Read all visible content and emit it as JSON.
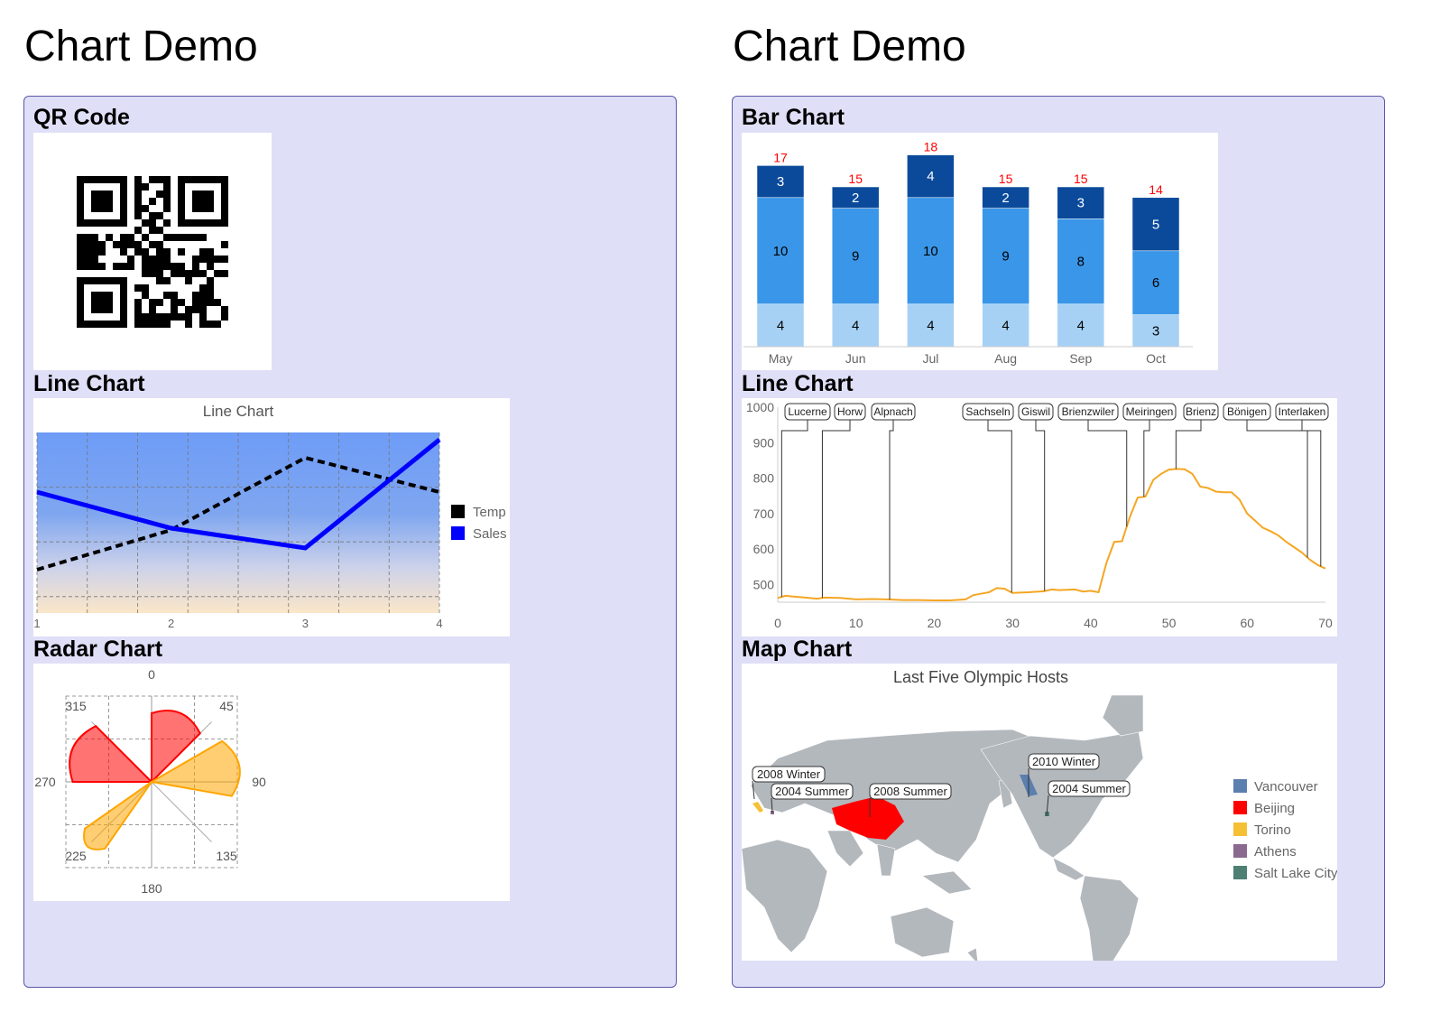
{
  "left": {
    "title": "Chart Demo",
    "qr_title": "QR Code",
    "line_title": "Line Chart",
    "radar_title": "Radar Chart"
  },
  "right": {
    "title": "Chart Demo",
    "bar_title": "Bar Chart",
    "line_title": "Line Chart",
    "map_title": "Map Chart"
  },
  "colors": {
    "panel_bg": "#dfdff7",
    "panel_border": "#5a5aa8",
    "bar_light": "#a6d1f5",
    "bar_mid": "#3a96e8",
    "bar_dark": "#0b4a9b",
    "total_label": "#ff0000",
    "profile_line": "#f5a623",
    "map_land": "#b3b8bd"
  },
  "chart_data": [
    {
      "id": "bar",
      "type": "bar",
      "stacked": true,
      "categories": [
        "May",
        "Jun",
        "Jul",
        "Aug",
        "Sep",
        "Oct"
      ],
      "series": [
        {
          "values": [
            4,
            4,
            4,
            4,
            4,
            3
          ]
        },
        {
          "values": [
            10,
            9,
            10,
            9,
            8,
            6
          ]
        },
        {
          "values": [
            3,
            2,
            4,
            2,
            3,
            5
          ]
        }
      ],
      "totals": [
        17,
        15,
        18,
        15,
        15,
        14
      ],
      "ylim": [
        0,
        19
      ],
      "xlabel": "",
      "ylabel": ""
    },
    {
      "id": "line-left",
      "type": "line",
      "title": "Line Chart",
      "x": [
        1,
        2,
        3,
        4
      ],
      "xticks": [
        "1",
        "2",
        "3",
        "4"
      ],
      "series": [
        {
          "name": "Temp",
          "values": [
            2.4,
            4.6,
            8.6,
            6.7
          ],
          "color": "#000000",
          "style": "dashed"
        },
        {
          "name": "Sales",
          "values": [
            6.7,
            4.7,
            3.6,
            9.6
          ],
          "color": "#0000ff",
          "style": "solid"
        }
      ],
      "ylim": [
        0,
        10
      ],
      "grid": true,
      "legend": "right",
      "background": "gradient blue to beige"
    },
    {
      "id": "radar",
      "type": "radar",
      "angle_ticks": [
        "0",
        "45",
        "90",
        "135",
        "180",
        "225",
        "270",
        "315"
      ],
      "series": [
        {
          "color": "#ff0000",
          "petals": [
            {
              "from": 270,
              "to": 315,
              "r": 0.92
            },
            {
              "from": 0,
              "to": 45,
              "r": 0.8
            }
          ]
        },
        {
          "color": "#ffa500",
          "petals": [
            {
              "from": 60,
              "to": 100,
              "r": 0.95
            },
            {
              "from": 215,
              "to": 235,
              "r": 0.95
            }
          ]
        }
      ],
      "grid": true
    },
    {
      "id": "line-right",
      "type": "line",
      "xlim": [
        0,
        70
      ],
      "xticks": [
        "0",
        "10",
        "20",
        "30",
        "40",
        "50",
        "60",
        "70"
      ],
      "ylim": [
        450,
        1000
      ],
      "yticks": [
        "500",
        "600",
        "700",
        "800",
        "900",
        "1000"
      ],
      "series": [
        {
          "color": "#f5a623",
          "x": [
            0,
            1,
            2,
            4,
            5,
            6,
            8,
            10,
            12,
            14,
            16,
            18,
            20,
            22,
            24,
            25,
            26,
            27,
            28,
            29,
            30,
            32,
            34,
            35,
            36,
            38,
            39,
            40,
            41,
            42,
            43,
            44,
            45,
            46,
            47,
            48,
            49,
            50,
            51,
            52,
            53,
            54,
            55,
            56,
            57,
            58,
            59,
            60,
            61,
            62,
            63,
            64,
            65,
            66,
            67,
            68,
            69,
            70
          ],
          "y": [
            462,
            468,
            466,
            462,
            460,
            463,
            462,
            458,
            459,
            458,
            456,
            456,
            455,
            455,
            458,
            470,
            474,
            478,
            490,
            488,
            476,
            478,
            481,
            486,
            484,
            486,
            480,
            482,
            478,
            560,
            620,
            622,
            690,
            745,
            748,
            795,
            812,
            824,
            826,
            825,
            812,
            776,
            772,
            762,
            760,
            760,
            740,
            700,
            680,
            660,
            650,
            638,
            620,
            605,
            590,
            570,
            555,
            545
          ]
        }
      ],
      "annotations": [
        {
          "label": "Lucerne",
          "x": 0.5
        },
        {
          "label": "Horw",
          "x": 5.7
        },
        {
          "label": "Alpnach",
          "x": 14.3
        },
        {
          "label": "Sachseln",
          "x": 29.9
        },
        {
          "label": "Giswil",
          "x": 34.1
        },
        {
          "label": "Brienzwiler",
          "x": 44.6
        },
        {
          "label": "Meiringen",
          "x": 46.8
        },
        {
          "label": "Brienz",
          "x": 50.9
        },
        {
          "label": "Bönigen",
          "x": 67.7
        },
        {
          "label": "Interlaken",
          "x": 69.4
        }
      ]
    },
    {
      "id": "map",
      "type": "map",
      "title": "Last Five Olympic Hosts",
      "legend": "right",
      "series": [
        {
          "name": "Vancouver",
          "color": "#5b7fae",
          "label": "2010 Winter"
        },
        {
          "name": "Beijing",
          "color": "#ff0000",
          "label": "2008 Summer"
        },
        {
          "name": "Torino",
          "color": "#f5c033",
          "label": "2008 Winter"
        },
        {
          "name": "Athens",
          "color": "#8a6a8e",
          "label": "2004 Summer"
        },
        {
          "name": "Salt Lake City",
          "color": "#4e7f73",
          "label": "2004 Summer"
        }
      ]
    }
  ]
}
